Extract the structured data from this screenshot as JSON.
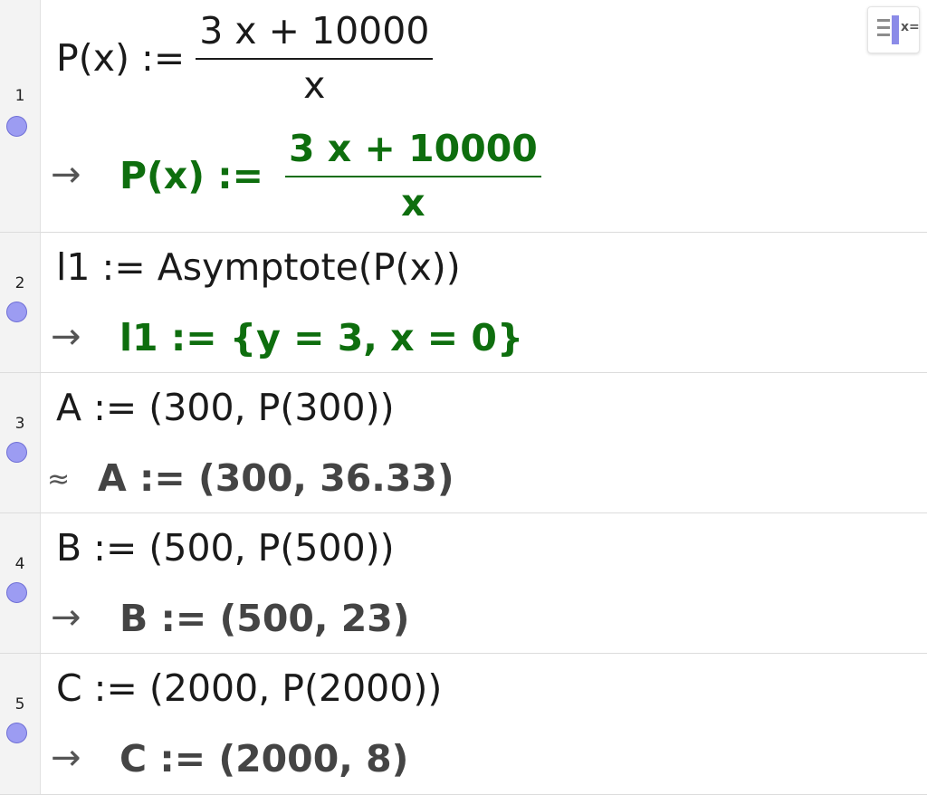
{
  "rows": [
    {
      "number": "1",
      "input_lhs": "P(x) :=",
      "input_num": "3 x + 10000",
      "input_den": "x",
      "output_symbol": "→",
      "output_lhs": "P(x)  :=",
      "output_num": "3 x + 10000",
      "output_den": "x"
    },
    {
      "number": "2",
      "input": "l1 := Asymptote(P(x))",
      "output_symbol": "→",
      "output": "l1 := {y = 3, x = 0}"
    },
    {
      "number": "3",
      "input": "A := (300, P(300))",
      "output_symbol": "≈",
      "output": "A  :=  (300, 36.33)"
    },
    {
      "number": "4",
      "input": "B := (500, P(500))",
      "output_symbol": "→",
      "output": "B  :=  (500, 23)"
    },
    {
      "number": "5",
      "input": "C := (2000, P(2000))",
      "output_symbol": "→",
      "output": "C  :=  (2000, 8)"
    }
  ],
  "toolbar": {
    "toggle_label": "x=",
    "toggle_icon": "algebra-toggle-icon"
  },
  "colors": {
    "output_green": "#0e6e0e",
    "output_gray": "#444444",
    "dot_fill": "#9c9cf2"
  }
}
